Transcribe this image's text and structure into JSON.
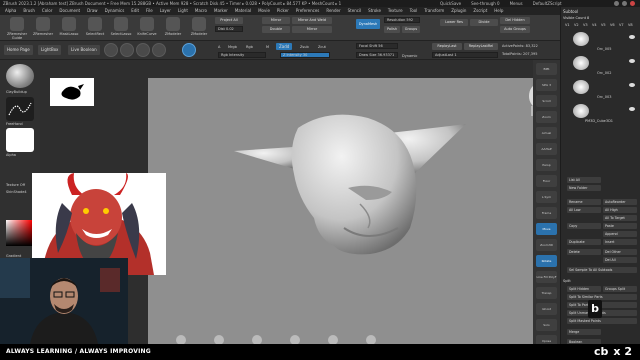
{
  "window": {
    "title": "ZBrush 2023.1.2 [Abraham test]   ZBrush Document   • Free Mem 15.288GB • Active Mem 928 • Scratch Disk 45 • Timer ▸ 0.028 • PolyCount ▸ 84.577 KP • MeshCount ▸ 1",
    "quicksave": "QuickSave",
    "seethrough": "See-through 0",
    "menus_label": "Menus",
    "default_script": "DefaultZScript"
  },
  "menubar": {
    "items": [
      "Alpha",
      "Brush",
      "Color",
      "Document",
      "Draw",
      "Dynamics",
      "Edit",
      "File",
      "Layer",
      "Light",
      "Macro",
      "Marker",
      "Material",
      "Movie",
      "Picker",
      "Preferences",
      "Render",
      "Stencil",
      "Stroke",
      "Texture",
      "Tool",
      "Transform",
      "Zplugin",
      "Zscript",
      "Help"
    ]
  },
  "shelf": {
    "tools": [
      {
        "label": "ZRemesher Guide",
        "icon": "zremesher-guide-icon"
      },
      {
        "label": "ZRemesher",
        "icon": "zremesher-icon"
      },
      {
        "label": "MaskLasso",
        "icon": "mask-lasso-icon"
      },
      {
        "label": "SelectRect",
        "icon": "select-rect-icon"
      },
      {
        "label": "SelectLasso",
        "icon": "select-lasso-icon"
      },
      {
        "label": "KnifeCurve",
        "icon": "knife-curve-icon"
      },
      {
        "label": "ZModeler",
        "icon": "zmodeler-icon"
      },
      {
        "label": "ZModeler",
        "icon": "zmodeler-icon"
      }
    ],
    "project_all": "Project All",
    "dist": "Dist 0.02",
    "mirror": "Mirror",
    "mirror_and_weld": "Mirror And Weld",
    "double": "Double",
    "mirror2": "Mirror",
    "dynamesh": "DynaMesh",
    "resolution": "Resolution 592",
    "polish": "Polish",
    "groups": "Groups",
    "divide": "Divide",
    "del_hidden": "Del Hidden",
    "auto_groups": "Auto Groups",
    "lower_res": "Lower Res",
    "higher_res": "Higher Res"
  },
  "shelf2": {
    "home_page": "Home Page",
    "lightbox": "LightBox",
    "live_boolean": "Live Boolean",
    "a_label": "A",
    "mrgb": "Mrgb",
    "rgb": "Rgb",
    "m": "M",
    "zadd": "Zadd",
    "zsub": "Zsub",
    "zcut": "Zcut",
    "rgb_intensity": "Rgb Intensity",
    "z_intensity": "Z Intensity 30",
    "focal_shift": "Focal Shift 56",
    "draw_size": "Draw Size 36.93371",
    "dynamic": "Dynamic",
    "replay_last": "ReplayLast",
    "replay_last_rel": "ReplayLastRel",
    "adjust_last": "AdjustLast 1",
    "active_points": "ActivePoints: 83,322",
    "total_points": "TotalPoints: 207,395"
  },
  "coords": "-0.296, 1.750, 0.245",
  "leftshelf": {
    "brush": "ClayBuildup",
    "alpha_label": "Alpha",
    "stroke": "FreeHand",
    "texture": "Texture Off",
    "material": "SkinShade4",
    "gradient": "Gradient",
    "switch_color": "SwitchColor",
    "alternate": "Alternate"
  },
  "rightcol": {
    "items": [
      "BPR",
      "SPix 3",
      "Scroll",
      "Zoom",
      "Actual",
      "AAHalf",
      "Persp",
      "Floor",
      "L.Sym",
      "Frame",
      "Move",
      "Zoom3D",
      "Rotate",
      "Line Fill PolyF",
      "Transp",
      "Ghost",
      "Solo",
      "Xpose"
    ]
  },
  "subtool": {
    "header": "Subtool",
    "visible_count": "Visible Count 8",
    "v_labels": [
      "V1",
      "V2",
      "V3",
      "V4",
      "V5",
      "V6",
      "V7",
      "V8"
    ],
    "items": [
      "Orc_005",
      "Orc_002",
      "Orc_003",
      "PM3D_Cube3D1"
    ],
    "list_all": "List All",
    "new_folder": "New Folder",
    "rename": "Rename",
    "auto_reorder": "AutoReorder",
    "all_low": "All Low",
    "all_high": "All High",
    "all_to_target": "All To Target",
    "copy": "Copy",
    "paste": "Paste",
    "append": "Append",
    "duplicate": "Duplicate",
    "insert": "Insert",
    "delete": "Delete",
    "del_other": "Del Other",
    "del_all": "Del All",
    "split_section": "Split",
    "split_hidden": "Split Hidden",
    "groups_split": "Groups Split",
    "split_similar": "Split To Similar Parts",
    "split_parts": "Split To Parts",
    "split_unmasked": "Split Unmasked Points",
    "split_masked": "Split Masked Points",
    "merge": "Merge",
    "boolean": "Boolean",
    "sel_sample": "Sel Sample To All Subtools"
  },
  "footer": {
    "tagline": "ALWAYS LEARNING  /  ALWAYS IMPROVING",
    "brand": "cb",
    "speed": "x 2"
  },
  "colors": {
    "accent_orange": "#c9721e",
    "accent_blue": "#2c79b8",
    "viewport_gray": "#8f8f8f"
  }
}
